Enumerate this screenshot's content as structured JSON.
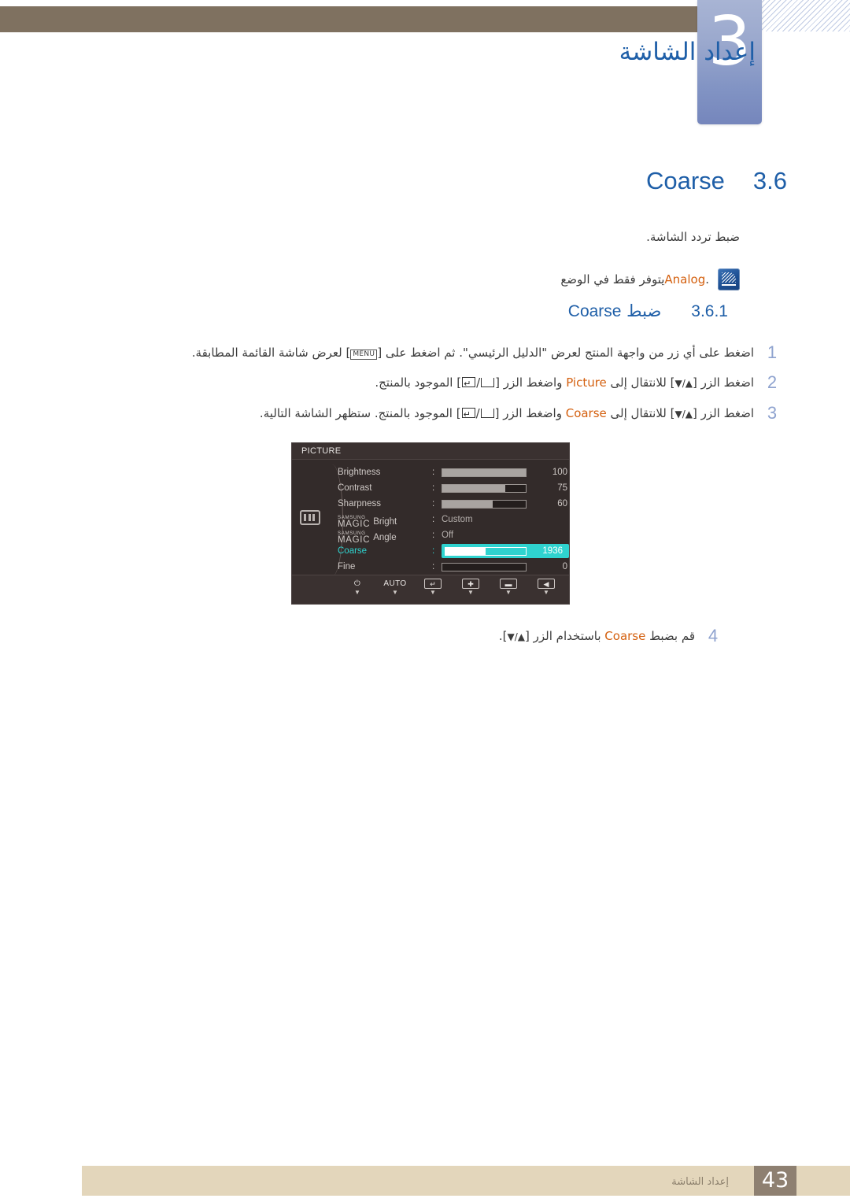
{
  "header": {
    "chapter_number": "3",
    "chapter_title": "إعداد الشاشة",
    "bar_color": "#7f7160",
    "tab_color": "#8294c4",
    "title_color": "#1f5fa8"
  },
  "section": {
    "number": "3.6",
    "name": "Coarse"
  },
  "intro": {
    "description": "ضبط تردد الشاشة.",
    "note_prefix": ".",
    "note_text_before": "يتوفر فقط في الوضع ",
    "note_keyword": "Analog",
    "note_text_after": "."
  },
  "subsection": {
    "number": "3.6.1",
    "label_ar": "ضبط",
    "label_en": "Coarse"
  },
  "steps": [
    {
      "num": "1",
      "text": "اضغط على أي زر من واجهة المنتج لعرض \"الدليل الرئيسي\". ثم اضغط على [MENU] لعرض شاشة القائمة المطابقة."
    },
    {
      "num": "2",
      "text": "اضغط الزر [▲/▼] للانتقال إلى Picture واضغط الزر [ /  ] الموجود بالمنتج.",
      "keyword": "Picture"
    },
    {
      "num": "3",
      "text": "اضغط الزر [▲/▼] للانتقال إلى Coarse واضغط الزر [ /  ] الموجود بالمنتج. ستظهر الشاشة التالية.",
      "keyword": "Coarse"
    },
    {
      "num": "4",
      "text": "قم بضبط Coarse باستخدام الزر [▲/▼].",
      "keyword": "Coarse"
    }
  ],
  "step_key_labels": {
    "menu": "MENU",
    "up_down": "▲/▼"
  },
  "osd": {
    "title": "PICTURE",
    "side_icon": "picture-bars-icon",
    "highlight_color": "#2fd3cf",
    "background_color": "#332b2a",
    "rows": [
      {
        "label": "Brightness",
        "type": "slider",
        "value": "100",
        "percent": 100
      },
      {
        "label": "Contrast",
        "type": "slider",
        "value": "75",
        "percent": 75
      },
      {
        "label": "Sharpness",
        "type": "slider",
        "value": "60",
        "percent": 60
      },
      {
        "label_brand": "SAMSUNG",
        "label_magic": "MAGIC",
        "label_suffix": "Bright",
        "type": "text",
        "value": "Custom"
      },
      {
        "label_brand": "SAMSUNG",
        "label_magic": "MAGIC",
        "label_suffix": "Angle",
        "type": "text",
        "value": "Off"
      },
      {
        "label": "Coarse",
        "type": "slider",
        "value": "1936",
        "percent": 50,
        "selected": true
      },
      {
        "label": "Fine",
        "type": "slider",
        "value": "0",
        "percent": 0
      }
    ],
    "footer_buttons": [
      {
        "icon": "left-arrow-icon",
        "glyph": "◀"
      },
      {
        "icon": "minus-icon",
        "glyph": "▬"
      },
      {
        "icon": "plus-icon",
        "glyph": "✚"
      },
      {
        "icon": "enter-icon",
        "glyph": "↵"
      },
      {
        "icon": "auto-button",
        "glyph": "AUTO"
      },
      {
        "icon": "power-icon",
        "glyph": "⏻"
      }
    ]
  },
  "footer": {
    "label": "إعداد الشاشة",
    "page_number": "43",
    "bar_color": "#e3d6bb",
    "page_box_color": "#8e8071"
  }
}
